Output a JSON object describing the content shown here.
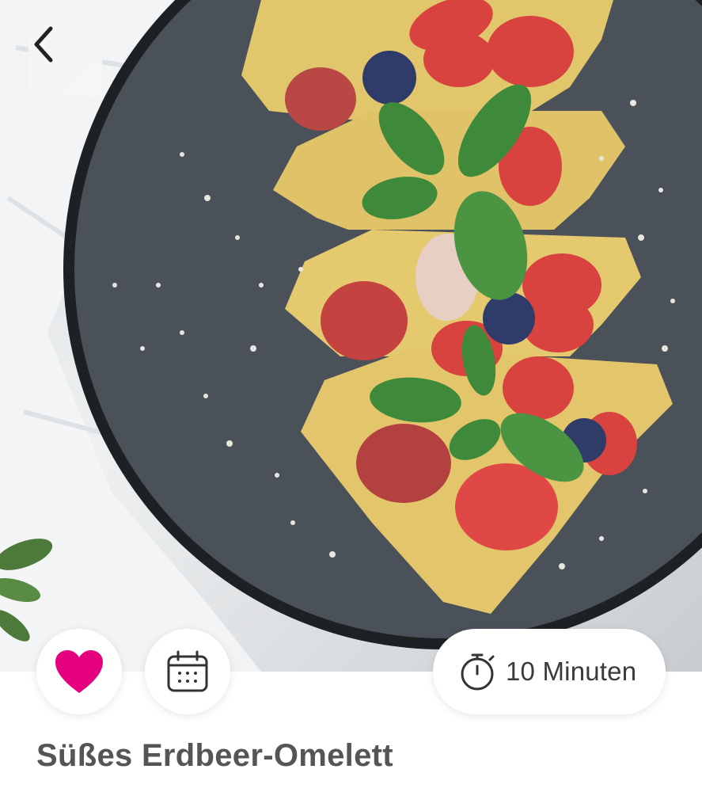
{
  "nav": {
    "back_icon": "chevron-left-icon"
  },
  "actions": {
    "favorite_icon": "heart-icon",
    "favorite_color": "#e5007e",
    "calendar_icon": "calendar-icon"
  },
  "recipe": {
    "time_icon": "stopwatch-icon",
    "time_label": "10 Minuten",
    "title": "Süßes Erdbeer-Omelett"
  },
  "colors": {
    "plate": "#4b5158",
    "omelette": "#e2c66c",
    "strawberry": "#d8423f",
    "mint": "#3f8a3a",
    "blueberry": "#2f3c6a",
    "title_text": "#555555"
  }
}
